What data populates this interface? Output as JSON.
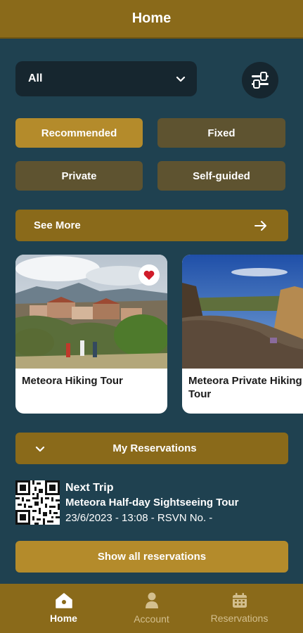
{
  "header": {
    "title": "Home"
  },
  "filter": {
    "selected": "All"
  },
  "chips": [
    {
      "label": "Recommended",
      "active": true
    },
    {
      "label": "Fixed",
      "active": false
    },
    {
      "label": "Private",
      "active": false
    },
    {
      "label": "Self-guided",
      "active": false
    }
  ],
  "see_more": {
    "label": "See More"
  },
  "tours": [
    {
      "title": "Meteora Hiking Tour",
      "favorite": true
    },
    {
      "title": "Meteora Private Hiking Tour",
      "favorite": false
    }
  ],
  "reservations": {
    "toggle_label": "My Reservations",
    "next_trip_heading": "Next Trip",
    "next_trip_name": "Meteora Half-day Sightseeing Tour",
    "next_trip_details": "23/6/2023 - 13:08 - RSVN No. -",
    "show_all_label": "Show all reservations"
  },
  "nav": [
    {
      "label": "Home",
      "icon": "home-icon",
      "active": true
    },
    {
      "label": "Account",
      "icon": "account-icon",
      "active": false
    },
    {
      "label": "Reservations",
      "icon": "calendar-icon",
      "active": false
    }
  ],
  "colors": {
    "background": "#1f4150",
    "brand": "#8a6a1a",
    "accent": "#b48b2b",
    "chip_inactive": "#5e5330"
  }
}
